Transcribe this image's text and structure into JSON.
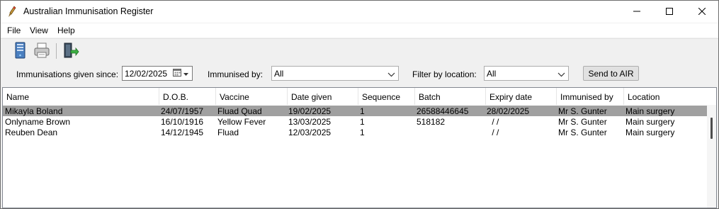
{
  "window": {
    "title": "Australian Immunisation Register",
    "icon": "syringe-icon",
    "controls": [
      "minimize-icon",
      "maximize-icon",
      "close-icon"
    ]
  },
  "menu": [
    "File",
    "View",
    "Help"
  ],
  "toolbar": {
    "buttons": [
      "server-icon",
      "printer-icon",
      "exit-door-icon"
    ]
  },
  "filters": {
    "since_label": "Immunisations given since:",
    "since_value": "12/02/2025",
    "immunised_by_label": "Immunised by:",
    "immunised_by_value": "All",
    "location_label": "Filter by location:",
    "location_value": "All",
    "send_label": "Send to AIR"
  },
  "table": {
    "columns": [
      "Name",
      "D.O.B.",
      "Vaccine",
      "Date given",
      "Sequence",
      "Batch",
      "Expiry date",
      "Immunised by",
      "Location"
    ],
    "rows": [
      [
        "Mikayla Boland",
        "24/07/1957",
        "Fluad Quad",
        "19/02/2025",
        "1",
        "26588446645",
        "28/02/2025",
        "Mr S. Gunter",
        "Main surgery"
      ],
      [
        "Onlyname Brown",
        "16/10/1916",
        "Yellow Fever",
        "13/03/2025",
        "1",
        "518182",
        " / /",
        "Mr S. Gunter",
        "Main surgery"
      ],
      [
        "Reuben Dean",
        "14/12/1945",
        "Fluad",
        "12/03/2025",
        "1",
        "",
        " / /",
        "Mr S. Gunter",
        "Main surgery"
      ]
    ],
    "selected_row": 0
  },
  "colors": {
    "selected_row": "#a0a0a0",
    "title_bg": "#ffffff",
    "window_bg": "#f0f0f0"
  }
}
